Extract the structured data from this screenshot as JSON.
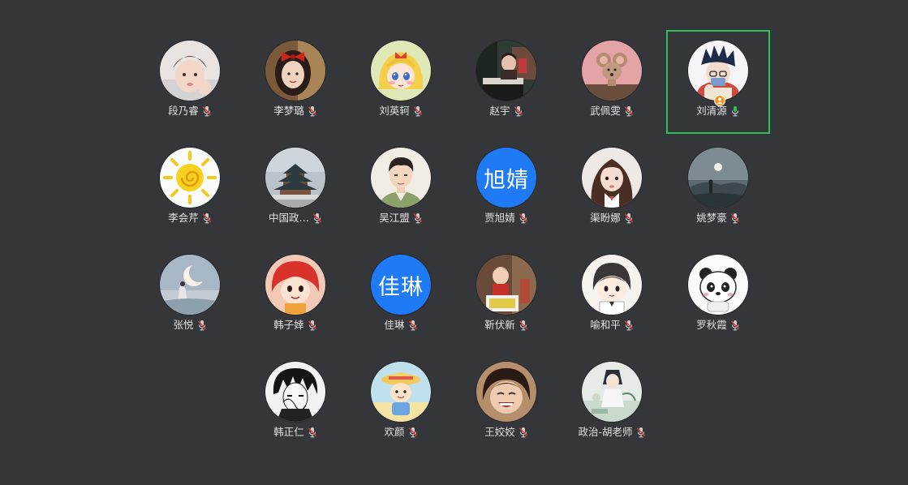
{
  "colors": {
    "background": "#35363a",
    "active_border": "#2fbf5b",
    "name_text": "#e3e3e3",
    "muted_mic": "#d9534f",
    "unmuted_mic": "#2fbf5b",
    "text_avatar": "#1e7bf5",
    "host_badge": "#f29a1f"
  },
  "participants": [
    {
      "name": "段乃睿",
      "mic": "muted",
      "avatar": "photo-baby"
    },
    {
      "name": "李梦璐",
      "mic": "muted",
      "avatar": "photo-girl-red-bow"
    },
    {
      "name": "刘英轲",
      "mic": "muted",
      "avatar": "cartoon-blonde-girl"
    },
    {
      "name": "赵宇",
      "mic": "muted",
      "avatar": "photo-piano"
    },
    {
      "name": "武佩雯",
      "mic": "muted",
      "avatar": "cartoon-mouse"
    },
    {
      "name": "刘清源",
      "mic": "unmuted",
      "avatar": "cartoon-boy",
      "active": true,
      "host_badge": true
    },
    {
      "name": "李会芹",
      "mic": "muted",
      "avatar": "sun"
    },
    {
      "name": "中国政…",
      "mic": "muted",
      "avatar": "temple"
    },
    {
      "name": "吴江盟",
      "mic": "muted",
      "avatar": "cartoon-man"
    },
    {
      "name": "贾旭婧",
      "mic": "muted",
      "avatar": "text",
      "avatar_text": "旭婧"
    },
    {
      "name": "渠盼娜",
      "mic": "muted",
      "avatar": "photo-girl"
    },
    {
      "name": "姚梦豪",
      "mic": "muted",
      "avatar": "moon-landscape"
    },
    {
      "name": "张悦",
      "mic": "muted",
      "avatar": "crescent-moon"
    },
    {
      "name": "韩子婞",
      "mic": "muted",
      "avatar": "cartoon-red-hair"
    },
    {
      "name": "佳琳",
      "mic": "muted",
      "avatar": "text",
      "avatar_text": "佳琳"
    },
    {
      "name": "靳伏新",
      "mic": "muted",
      "avatar": "photo-kid"
    },
    {
      "name": "喻和平",
      "mic": "muted",
      "avatar": "cartoon-chibi"
    },
    {
      "name": "罗秋霞",
      "mic": "muted",
      "avatar": "panda"
    },
    {
      "name": "韩正仁",
      "mic": "muted",
      "avatar": "manga-sketch"
    },
    {
      "name": "欢颜",
      "mic": "muted",
      "avatar": "cartoon-hat-kid"
    },
    {
      "name": "王姣姣",
      "mic": "muted",
      "avatar": "photo-smile-kid"
    },
    {
      "name": "政治-胡老师",
      "mic": "muted",
      "avatar": "watercolor-girl"
    }
  ]
}
